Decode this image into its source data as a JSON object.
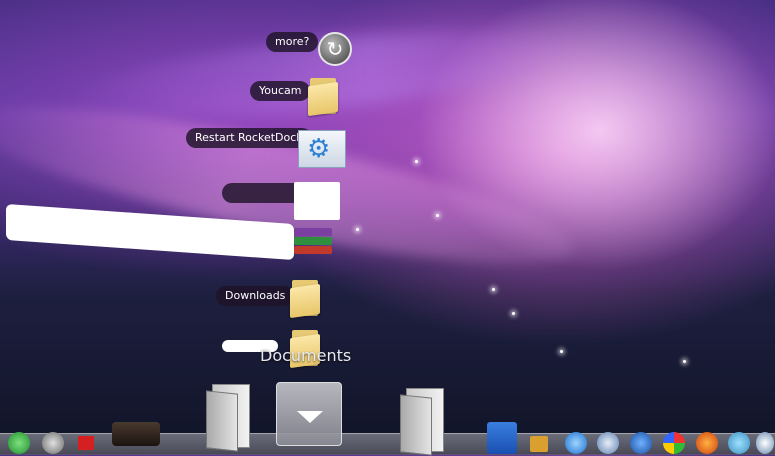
{
  "stack": {
    "items": [
      {
        "label": "more?",
        "icon": "arrow-circle-icon"
      },
      {
        "label": "Youcam",
        "icon": "folder-icon"
      },
      {
        "label": "Restart RocketDock",
        "icon": "gear-document-icon"
      },
      {
        "label": "",
        "icon": "blank-document-icon"
      },
      {
        "label": "",
        "icon": "winrar-icon"
      },
      {
        "label": "Downloads",
        "icon": "folder-icon"
      },
      {
        "label": "",
        "icon": "folder-icon"
      }
    ],
    "title": "Documents"
  },
  "dock": {
    "icons": [
      "refresh-icon",
      "network-user-icon",
      "flag-icon",
      "projector-icon",
      "folder-icon",
      "stack-toggle-icon",
      "folder-icon",
      "ipod-icon",
      "media-player-icon",
      "quicktime-icon",
      "safari-icon",
      "earth-icon",
      "windows-icon",
      "firefox-icon",
      "yahoo-icon",
      "disc-icon"
    ]
  },
  "colors": {
    "label_bg": "#1e1428",
    "shelf": "#8a8a96",
    "accent_blue": "#2f7fd6"
  }
}
